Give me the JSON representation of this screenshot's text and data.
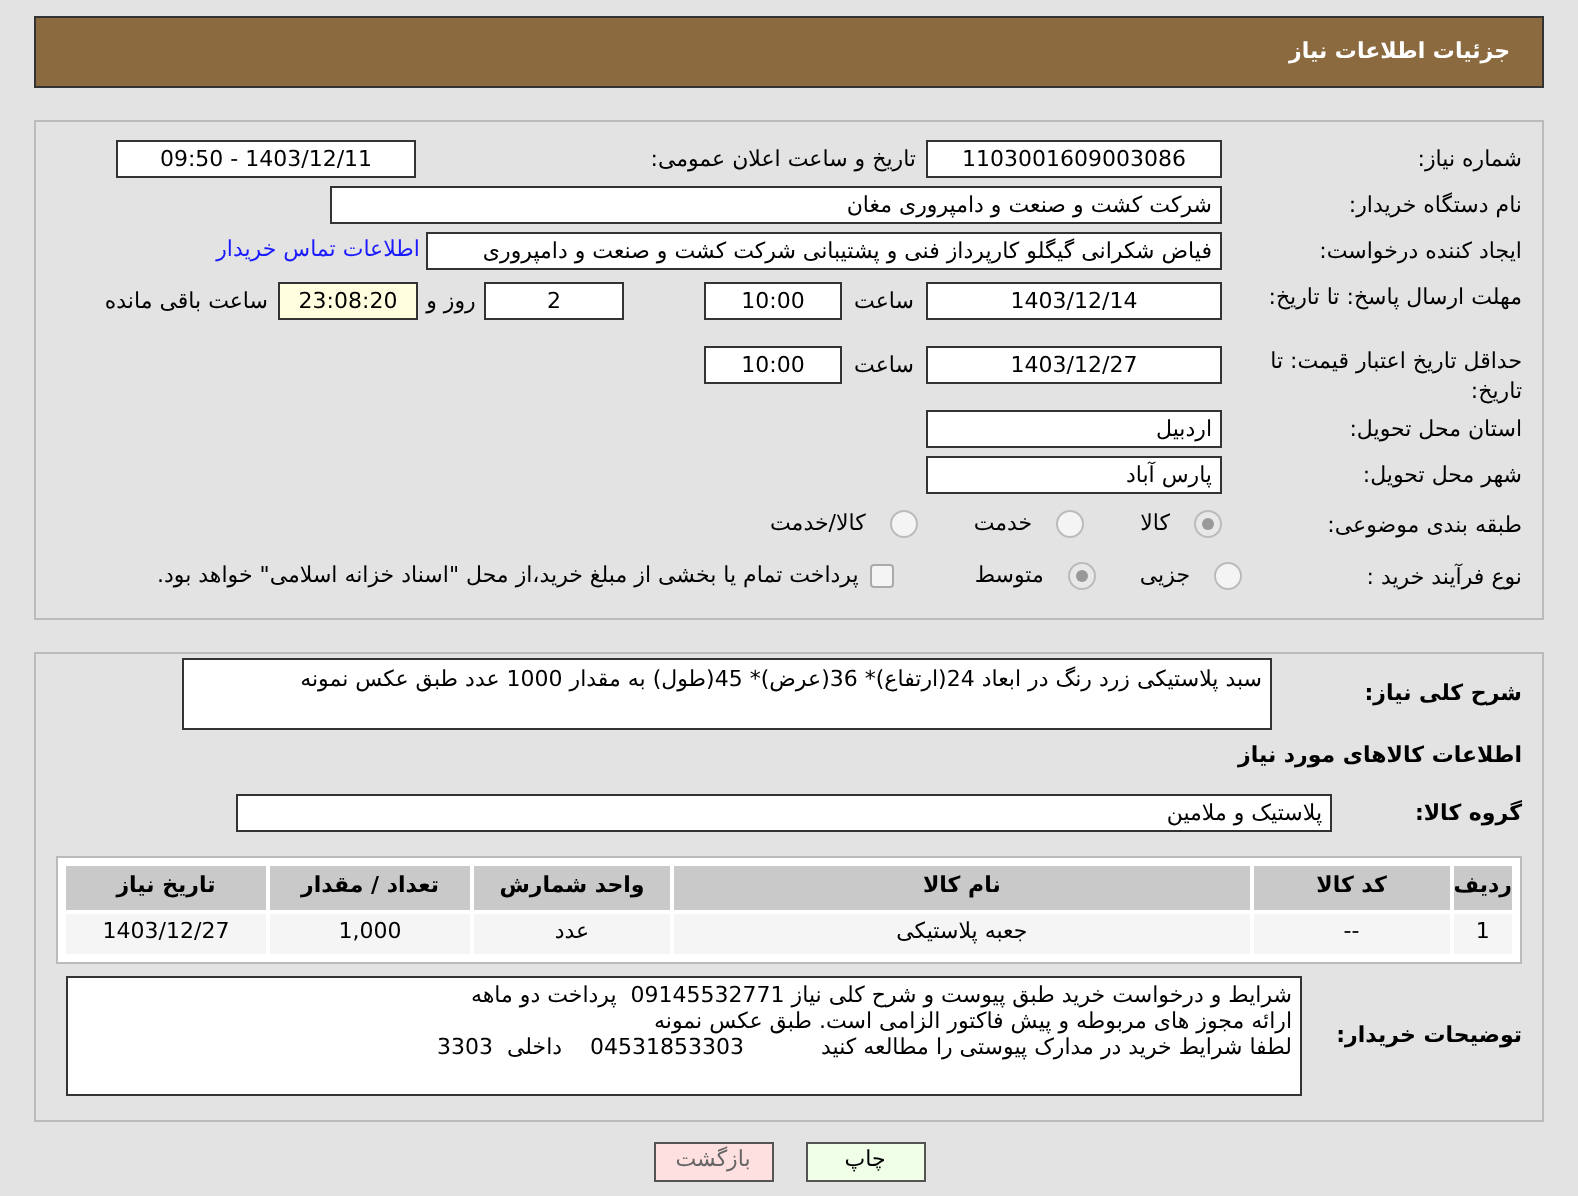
{
  "header": {
    "title": "جزئیات اطلاعات نیاز"
  },
  "need_info": {
    "need_number": {
      "label": "شماره نیاز:",
      "value": "1103001609003086"
    },
    "announce": {
      "label": "تاریخ و ساعت اعلان عمومی:",
      "value": "1403/12/11 - 09:50"
    },
    "buyer_org": {
      "label": "نام دستگاه خریدار:",
      "value": "شرکت کشت و صنعت و دامپروری مغان"
    },
    "requester": {
      "label": "ایجاد کننده درخواست:",
      "value": "فیاض شکرانی گیگلو کارپرداز فنی و پشتیبانی شرکت کشت و صنعت و دامپروری",
      "link": "اطلاعات تماس خریدار"
    },
    "reply_deadline": {
      "label": "مهلت ارسال پاسخ: تا تاریخ:",
      "date": "1403/12/14",
      "time_label": "ساعت",
      "time": "10:00",
      "days": "2",
      "days_label": "روز و",
      "remaining": "23:08:20",
      "remaining_label": "ساعت باقی مانده"
    },
    "price_validity": {
      "label": "حداقل تاریخ اعتبار قیمت: تا تاریخ:",
      "date": "1403/12/27",
      "time_label": "ساعت",
      "time": "10:00"
    },
    "province": {
      "label": "استان محل تحویل:",
      "value": "اردبیل"
    },
    "city": {
      "label": "شهر محل تحویل:",
      "value": "پارس آباد"
    },
    "category": {
      "label": "طبقه بندی موضوعی:",
      "options": [
        {
          "label": "کالا",
          "selected": true
        },
        {
          "label": "خدمت",
          "selected": false
        },
        {
          "label": "کالا/خدمت",
          "selected": false
        }
      ]
    },
    "process": {
      "label": "نوع فرآیند خرید :",
      "options": [
        {
          "label": "جزیی",
          "selected": false
        },
        {
          "label": "متوسط",
          "selected": true
        }
      ],
      "payment": {
        "checked": false,
        "text": "پرداخت تمام یا بخشی از مبلغ خرید،از محل \"اسناد خزانه اسلامی\" خواهد بود."
      }
    }
  },
  "details": {
    "description": {
      "label": "شرح کلی نیاز:",
      "value": "سبد پلاستیکی زرد رنگ در ابعاد 24(ارتفاع)* 36(عرض)* 45(طول) به مقدار 1000 عدد طبق عکس نمونه"
    },
    "goods_title": "اطلاعات کالاهای مورد نیاز",
    "goods_group": {
      "label": "گروه کالا:",
      "value": "پلاستیک و ملامین"
    },
    "table": {
      "columns": [
        "ردیف",
        "کد کالا",
        "نام کالا",
        "واحد شمارش",
        "تعداد / مقدار",
        "تاریخ نیاز"
      ],
      "rows": [
        [
          "1",
          "--",
          "جعبه پلاستیکی",
          "عدد",
          "1,000",
          "1403/12/27"
        ]
      ]
    },
    "buyer_notes": {
      "label": "توضیحات خریدار:",
      "lines": [
        "شرایط و درخواست خرید طبق پیوست و شرح کلی نیاز 09145532771  پرداخت دو ماهه",
        "ارائه مجوز های مربوطه و پیش فاکتور الزامی است. طبق عکس نمونه",
        "لطفا شرایط خرید در مدارک پیوستی را مطالعه کنید           04531853303    داخلی  3303"
      ]
    }
  },
  "buttons": [
    {
      "kind": "print",
      "label": "چاپ"
    },
    {
      "kind": "back",
      "label": "بازگشت"
    }
  ]
}
